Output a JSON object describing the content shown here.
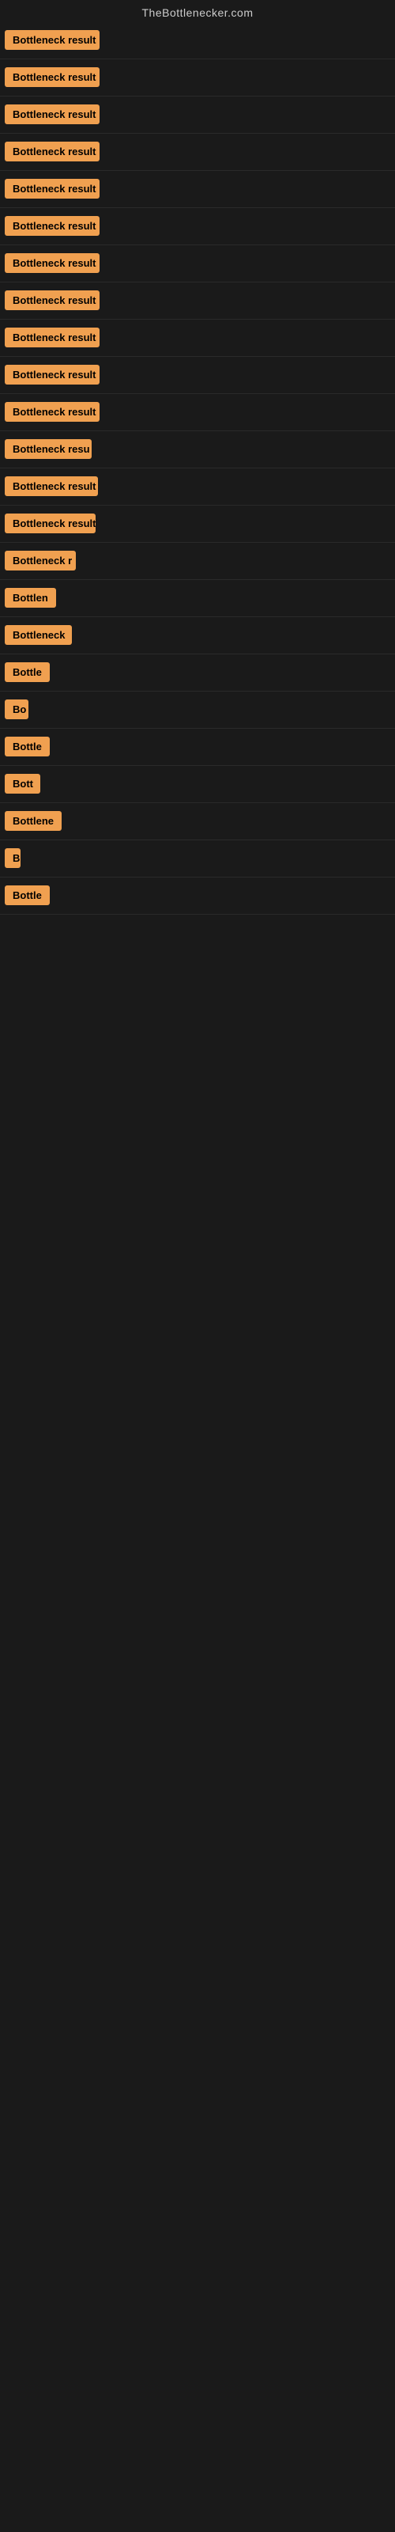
{
  "site": {
    "title": "TheBottlenecker.com"
  },
  "results": [
    {
      "id": 1,
      "label": "Bottleneck result",
      "width": 120
    },
    {
      "id": 2,
      "label": "Bottleneck result",
      "width": 120
    },
    {
      "id": 3,
      "label": "Bottleneck result",
      "width": 120
    },
    {
      "id": 4,
      "label": "Bottleneck result",
      "width": 120
    },
    {
      "id": 5,
      "label": "Bottleneck result",
      "width": 120
    },
    {
      "id": 6,
      "label": "Bottleneck result",
      "width": 120
    },
    {
      "id": 7,
      "label": "Bottleneck result",
      "width": 120
    },
    {
      "id": 8,
      "label": "Bottleneck result",
      "width": 120
    },
    {
      "id": 9,
      "label": "Bottleneck result",
      "width": 120
    },
    {
      "id": 10,
      "label": "Bottleneck result",
      "width": 120
    },
    {
      "id": 11,
      "label": "Bottleneck result",
      "width": 120
    },
    {
      "id": 12,
      "label": "Bottleneck resu",
      "width": 110
    },
    {
      "id": 13,
      "label": "Bottleneck result",
      "width": 118
    },
    {
      "id": 14,
      "label": "Bottleneck result",
      "width": 115
    },
    {
      "id": 15,
      "label": "Bottleneck r",
      "width": 90
    },
    {
      "id": 16,
      "label": "Bottlen",
      "width": 70
    },
    {
      "id": 17,
      "label": "Bottleneck",
      "width": 85
    },
    {
      "id": 18,
      "label": "Bottle",
      "width": 60
    },
    {
      "id": 19,
      "label": "Bo",
      "width": 30
    },
    {
      "id": 20,
      "label": "Bottle",
      "width": 60
    },
    {
      "id": 21,
      "label": "Bott",
      "width": 45
    },
    {
      "id": 22,
      "label": "Bottlene",
      "width": 72
    },
    {
      "id": 23,
      "label": "B",
      "width": 20
    },
    {
      "id": 24,
      "label": "Bottle",
      "width": 62
    }
  ],
  "colors": {
    "badge_bg": "#f0a050",
    "badge_text": "#000000",
    "page_bg": "#1a1a1a",
    "title_text": "#cccccc"
  }
}
